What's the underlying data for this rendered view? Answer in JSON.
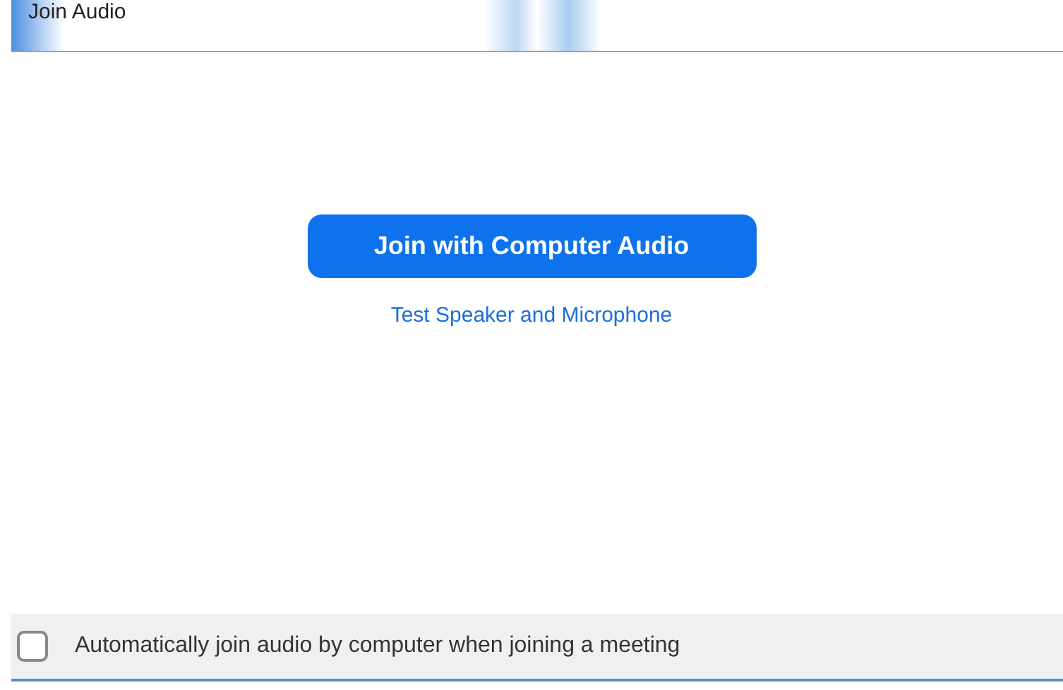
{
  "window": {
    "title": "Join Audio"
  },
  "join_button": {
    "label": "Join with Computer Audio"
  },
  "test_link": {
    "label": "Test Speaker and Microphone"
  },
  "auto_join": {
    "label": "Automatically join audio by computer when joining a meeting",
    "checked": false
  }
}
